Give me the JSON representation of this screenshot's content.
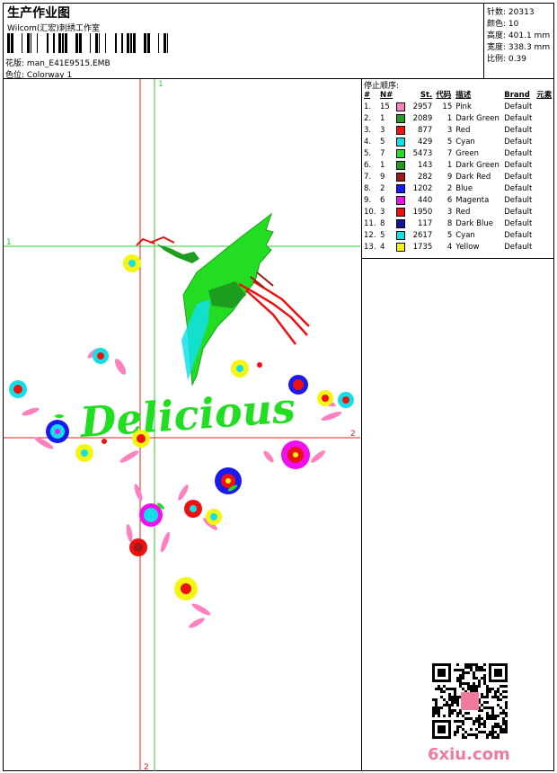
{
  "header": {
    "title": "生产作业图",
    "subtitle": "Wilcom(汇宏)刺绣工作室",
    "design_label": "花版:",
    "design_file": "man_E41E9515.EMB",
    "colorway_label": "色位:",
    "colorway": "Colorway 1"
  },
  "stats": {
    "stitches_label": "针数:",
    "stitches": "20313",
    "colors_label": "颜色:",
    "colors": "10",
    "height_label": "高度:",
    "height": "401.1 mm",
    "width_label": "宽度:",
    "width": "338.3 mm",
    "scale_label": "比例:",
    "scale": "0.39"
  },
  "stop_sequence": {
    "title": "停止顺序:",
    "headers": {
      "index": "#",
      "needle": "N#",
      "stitches": "St.",
      "code": "代码",
      "desc": "描述",
      "brand": "Brand",
      "element": "元素"
    },
    "rows": [
      {
        "index": "1.",
        "needle": "15",
        "color": "#ff7fbf",
        "stitches": "2957",
        "code": "15",
        "desc": "Pink",
        "brand": "Default"
      },
      {
        "index": "2.",
        "needle": "1",
        "color": "#1e9e1e",
        "stitches": "2089",
        "code": "1",
        "desc": "Dark Green",
        "brand": "Default"
      },
      {
        "index": "3.",
        "needle": "3",
        "color": "#ee1111",
        "stitches": "877",
        "code": "3",
        "desc": "Red",
        "brand": "Default"
      },
      {
        "index": "4.",
        "needle": "5",
        "color": "#11e0e8",
        "stitches": "429",
        "code": "5",
        "desc": "Cyan",
        "brand": "Default"
      },
      {
        "index": "5.",
        "needle": "7",
        "color": "#22dd22",
        "stitches": "5473",
        "code": "7",
        "desc": "Green",
        "brand": "Default"
      },
      {
        "index": "6.",
        "needle": "1",
        "color": "#1e9e1e",
        "stitches": "143",
        "code": "1",
        "desc": "Dark Green",
        "brand": "Default"
      },
      {
        "index": "7.",
        "needle": "9",
        "color": "#a01818",
        "stitches": "282",
        "code": "9",
        "desc": "Dark Red",
        "brand": "Default"
      },
      {
        "index": "8.",
        "needle": "2",
        "color": "#1a1aee",
        "stitches": "1202",
        "code": "2",
        "desc": "Blue",
        "brand": "Default"
      },
      {
        "index": "9.",
        "needle": "6",
        "color": "#ee11ee",
        "stitches": "440",
        "code": "6",
        "desc": "Magenta",
        "brand": "Default"
      },
      {
        "index": "10.",
        "needle": "3",
        "color": "#ee1111",
        "stitches": "1950",
        "code": "3",
        "desc": "Red",
        "brand": "Default"
      },
      {
        "index": "11.",
        "needle": "8",
        "color": "#141490",
        "stitches": "117",
        "code": "8",
        "desc": "Dark Blue",
        "brand": "Default"
      },
      {
        "index": "12.",
        "needle": "5",
        "color": "#11e0e8",
        "stitches": "2617",
        "code": "5",
        "desc": "Cyan",
        "brand": "Default"
      },
      {
        "index": "13.",
        "needle": "4",
        "color": "#f5f511",
        "stitches": "1735",
        "code": "4",
        "desc": "Yellow",
        "brand": "Default"
      }
    ]
  },
  "design": {
    "word": "Delicious",
    "axis_labels": {
      "v1_top": "1",
      "h1_left": "1",
      "h2_right": "2",
      "v2_bottom": "2"
    },
    "colors": {
      "green": "#22dd22",
      "dark_green": "#1e9e1e",
      "cyan": "#11e0e8",
      "red": "#ee1111",
      "pink": "#ff7fbf",
      "blue": "#1a1aee",
      "yellow": "#f5f511",
      "axis_green": "#33cc33",
      "axis_red": "#dd2222"
    }
  },
  "watermark": {
    "text": "6xiu.com",
    "color": "#f07a9a"
  }
}
